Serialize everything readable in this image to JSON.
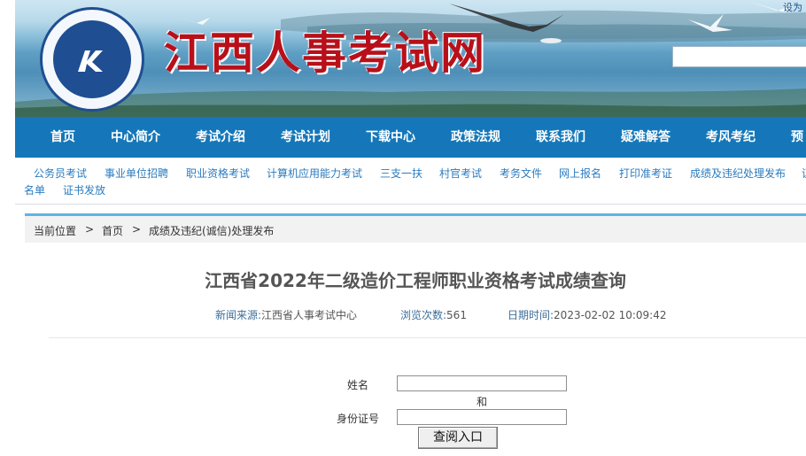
{
  "header": {
    "site_title": "江西人事考试网",
    "top_link": "设为"
  },
  "nav": {
    "items": [
      "首页",
      "中心简介",
      "考试介绍",
      "考试计划",
      "下载中心",
      "政策法规",
      "联系我们",
      "疑难解答",
      "考风考纪",
      "预约"
    ]
  },
  "subnav": {
    "items": [
      "公务员考试",
      "事业单位招聘",
      "职业资格考试",
      "计算机应用能力考试",
      "三支一扶",
      "村官考试",
      "考务文件",
      "网上报名",
      "打印准考证",
      "成绩及违纪处理发布",
      "证",
      "名单",
      "证书发放"
    ]
  },
  "breadcrumb": {
    "label": "当前位置",
    "sep": ">",
    "home": "首页",
    "current": "成绩及违纪(诚信)处理发布"
  },
  "article": {
    "title": "江西省2022年二级造价工程师职业资格考试成绩查询",
    "source_label": "新闻来源:",
    "source_value": "江西省人事考试中心",
    "views_label": "浏览次数:",
    "views_value": "561",
    "date_label": "日期时间:",
    "date_value": "2023-02-02 10:09:42"
  },
  "form": {
    "name_label": "姓名",
    "name_value": "",
    "and_text": "和",
    "id_label": "身份证号",
    "id_value": "",
    "submit_label": "查阅入口"
  },
  "colors": {
    "nav_bg": "#1577b9",
    "title_red": "#b8101a",
    "sub_link": "#2a7bbf",
    "frame_top": "#62b3e3"
  }
}
